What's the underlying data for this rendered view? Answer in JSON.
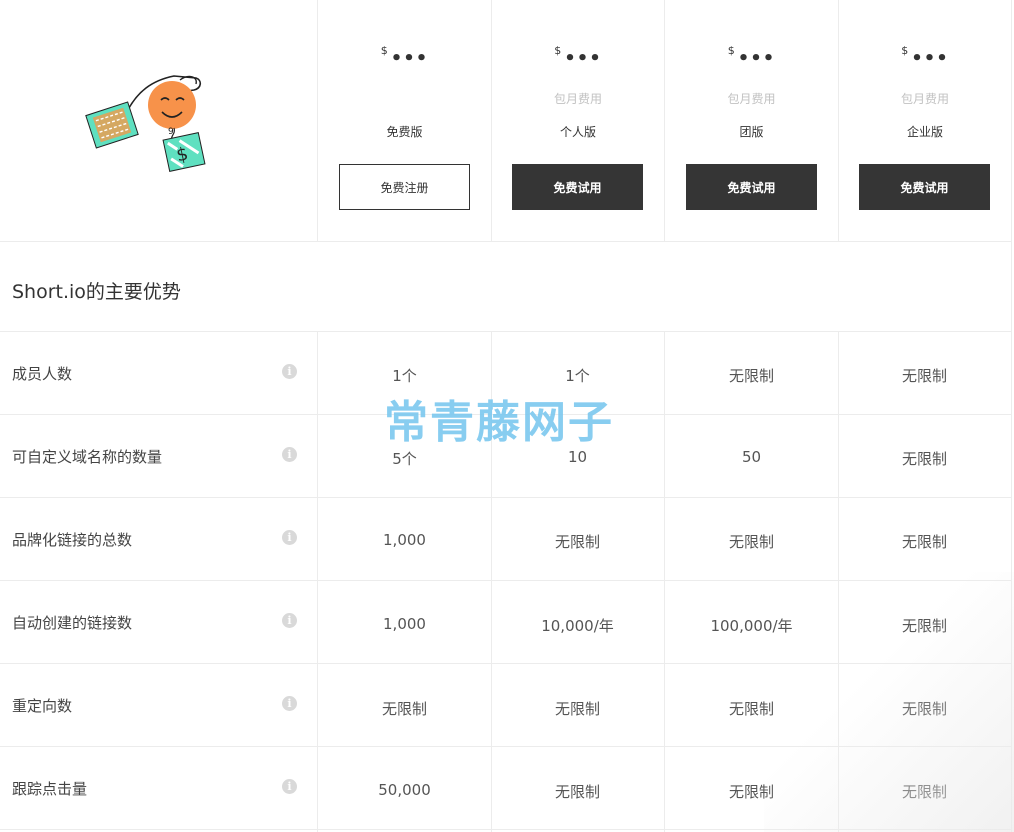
{
  "plans": [
    {
      "currency": "$",
      "price": "•••",
      "period": "",
      "name": "免费版",
      "cta": "免费注册",
      "style": "outline"
    },
    {
      "currency": "$",
      "price": "•••",
      "period": "包月费用",
      "name": "个人版",
      "cta": "免费试用",
      "style": "dark"
    },
    {
      "currency": "$",
      "price": "•••",
      "period": "包月费用",
      "name": "团版",
      "cta": "免费试用",
      "style": "dark"
    },
    {
      "currency": "$",
      "price": "•••",
      "period": "包月费用",
      "name": "企业版",
      "cta": "免费试用",
      "style": "dark"
    }
  ],
  "section_title": "Short.io的主要优势",
  "info_glyph": "i",
  "rows": [
    {
      "label": "成员人数",
      "values": [
        "1个",
        "1个",
        "无限制",
        "无限制"
      ]
    },
    {
      "label": "可自定义域名称的数量",
      "values": [
        "5个",
        "10",
        "50",
        "无限制"
      ]
    },
    {
      "label": "品牌化链接的总数",
      "values": [
        "1,000",
        "无限制",
        "无限制",
        "无限制"
      ]
    },
    {
      "label": "自动创建的链接数",
      "values": [
        "1,000",
        "10,000/年",
        "100,000/年",
        "无限制"
      ]
    },
    {
      "label": "重定向数",
      "values": [
        "无限制",
        "无限制",
        "无限制",
        "无限制"
      ]
    },
    {
      "label": "跟踪点击量",
      "values": [
        "50,000",
        "无限制",
        "无限制",
        "无限制"
      ]
    }
  ],
  "watermark": "常青藤网子",
  "colors": {
    "dark_button": "#353535",
    "watermark": "#7cc8ef",
    "illustration_face": "#f7924a",
    "illustration_card": "#5fe0c0"
  },
  "icons": {
    "info": "info-icon",
    "illustration": "hand-money-illustration"
  }
}
